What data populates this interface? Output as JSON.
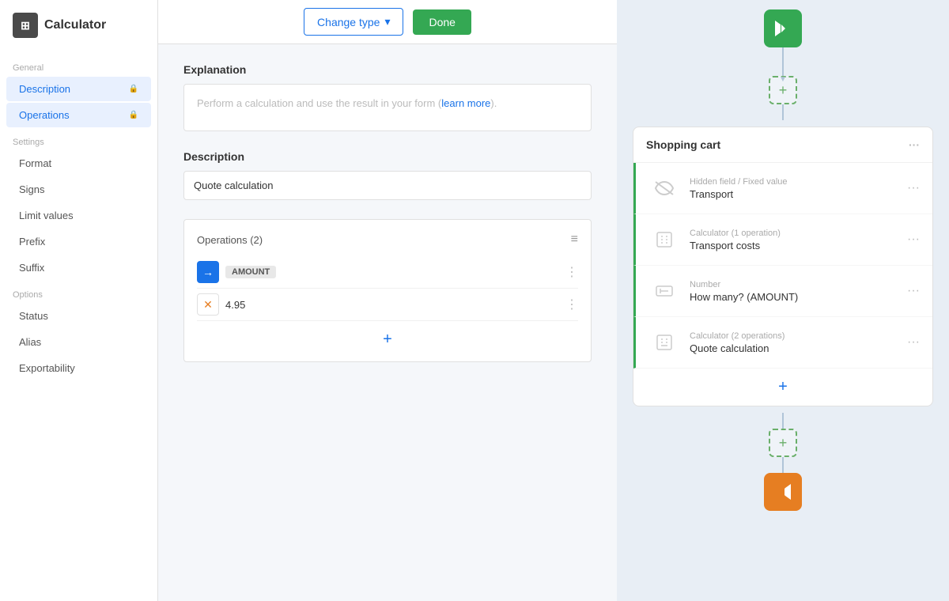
{
  "app": {
    "title": "Calculator",
    "logo_text": "⊞"
  },
  "topbar": {
    "change_type_label": "Change type",
    "done_label": "Done"
  },
  "sidebar": {
    "general_label": "General",
    "description_label": "Description",
    "operations_label": "Operations",
    "settings_label": "Settings",
    "format_label": "Format",
    "signs_label": "Signs",
    "limit_values_label": "Limit values",
    "prefix_label": "Prefix",
    "suffix_label": "Suffix",
    "options_label": "Options",
    "status_label": "Status",
    "alias_label": "Alias",
    "exportability_label": "Exportability"
  },
  "editor": {
    "explanation_title": "Explanation",
    "explanation_placeholder": "Perform a calculation and use the result in your form (",
    "explanation_link": "learn more",
    "explanation_suffix": ").",
    "description_title": "Description",
    "description_value": "Quote calculation",
    "operations_title": "Operations (2)",
    "op1_tag": "AMOUNT",
    "op2_value": "4.95",
    "add_operation_label": "+"
  },
  "right_panel": {
    "shopping_cart_title": "Shopping cart",
    "items": [
      {
        "type": "Hidden field / Fixed value",
        "name": "Transport"
      },
      {
        "type": "Calculator (1 operation)",
        "name": "Transport costs"
      },
      {
        "type": "Number",
        "name": "How many? (AMOUNT)"
      },
      {
        "type": "Calculator (2 operations)",
        "name": "Quote calculation"
      }
    ]
  }
}
